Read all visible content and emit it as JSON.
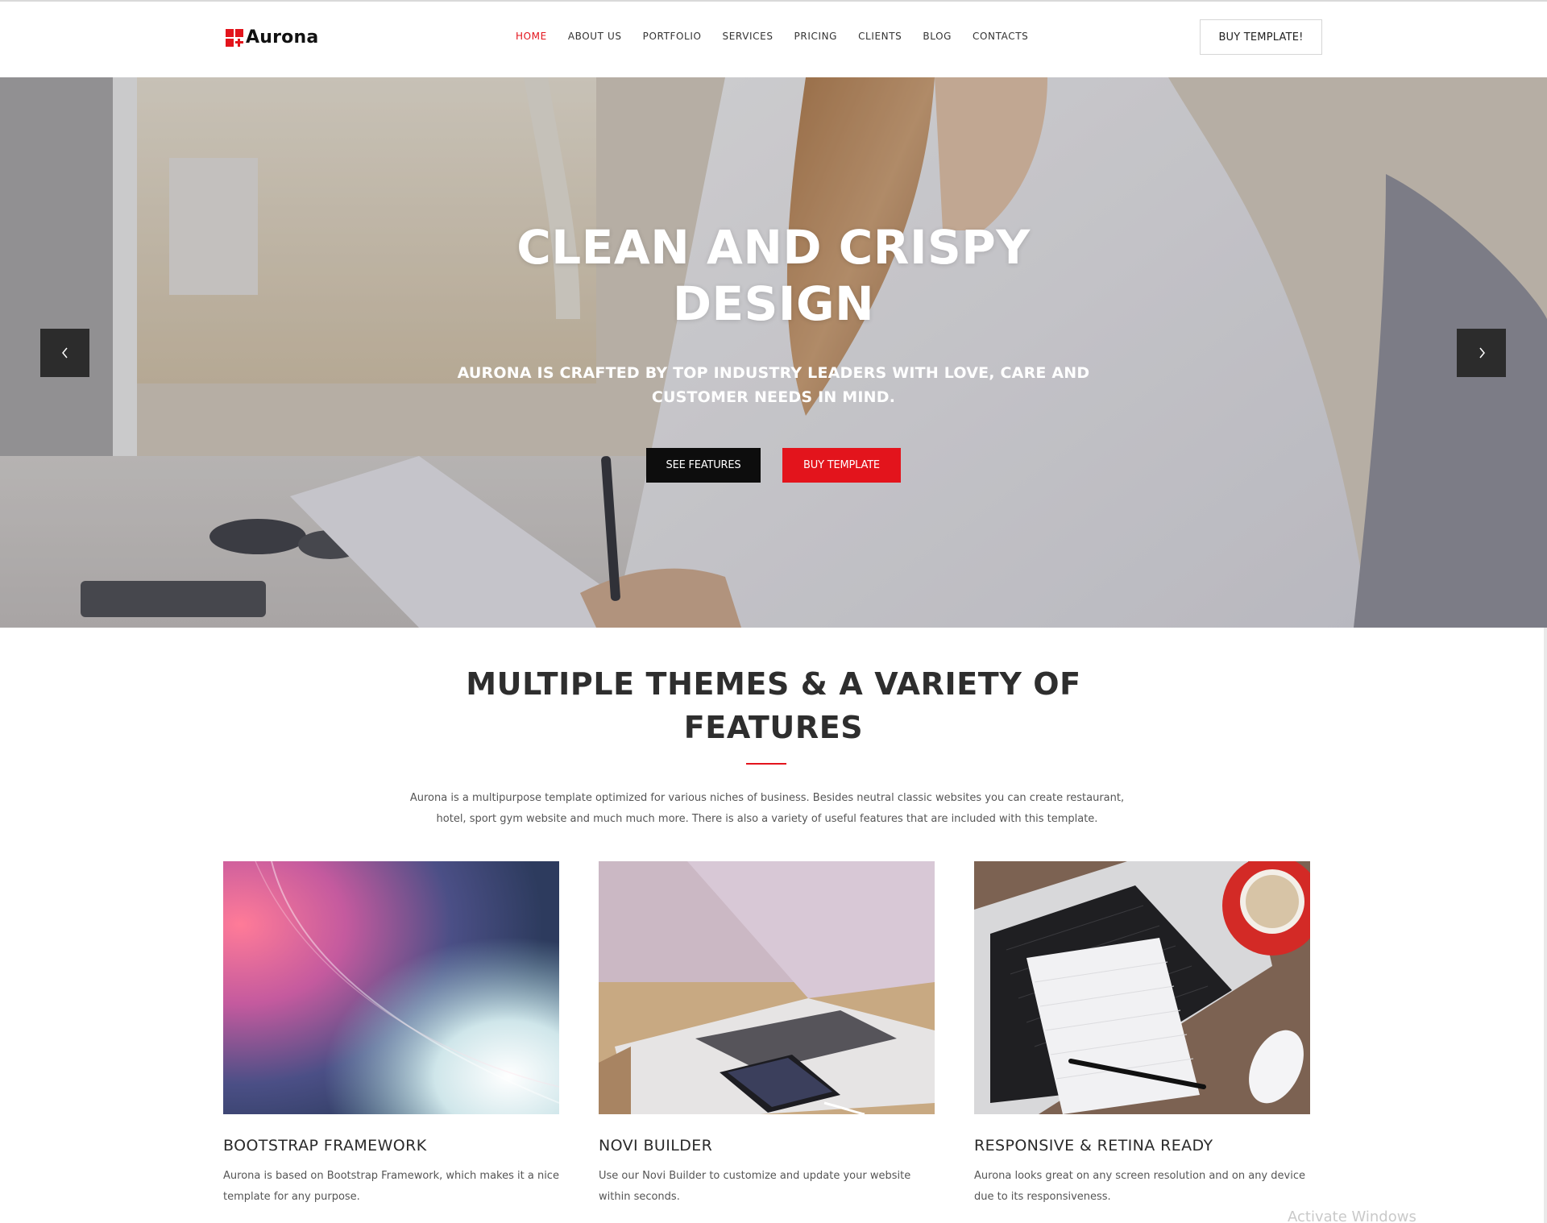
{
  "brand": {
    "name": "Aurona",
    "accent_color": "#e3141c"
  },
  "nav": {
    "items": [
      {
        "label": "HOME",
        "active": true
      },
      {
        "label": "ABOUT US",
        "active": false
      },
      {
        "label": "PORTFOLIO",
        "active": false
      },
      {
        "label": "SERVICES",
        "active": false
      },
      {
        "label": "PRICING",
        "active": false
      },
      {
        "label": "CLIENTS",
        "active": false
      },
      {
        "label": "BLOG",
        "active": false
      },
      {
        "label": "CONTACTS",
        "active": false
      }
    ],
    "cta_label": "BUY TEMPLATE!"
  },
  "hero": {
    "title": "CLEAN AND CRISPY DESIGN",
    "subtitle": "AURONA IS CRAFTED BY TOP INDUSTRY LEADERS WITH LOVE, CARE AND CUSTOMER NEEDS IN MIND.",
    "primary_button": "SEE FEATURES",
    "secondary_button": "BUY TEMPLATE",
    "prev_icon": "chevron-left-icon",
    "next_icon": "chevron-right-icon"
  },
  "features": {
    "title": "MULTIPLE THEMES & A VARIETY OF FEATURES",
    "description": "Aurona is a multipurpose template optimized for various niches of business. Besides neutral classic websites you can create restaurant, hotel, sport gym website and much much more. There is also a variety of useful features that are included with this template.",
    "cards": [
      {
        "title": "BOOTSTRAP FRAMEWORK",
        "text": "Aurona is based on Bootstrap Framework, which makes it a nice template for any purpose."
      },
      {
        "title": "NOVI BUILDER",
        "text": "Use our Novi Builder to customize and update your website within seconds."
      },
      {
        "title": "RESPONSIVE & RETINA READY",
        "text": "Aurona looks great on any screen resolution and on any device due to its responsiveness."
      }
    ]
  },
  "os_watermark": "Activate Windows"
}
